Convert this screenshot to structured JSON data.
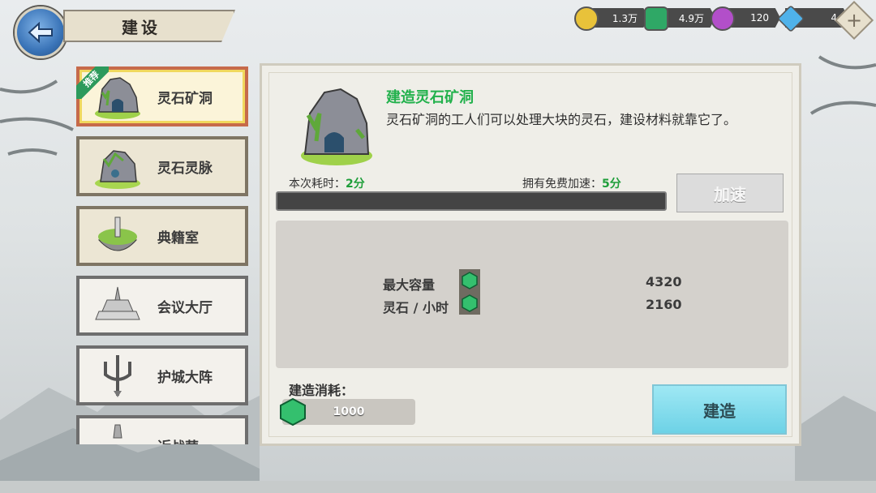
{
  "header": {
    "title": "建设"
  },
  "resources": [
    {
      "name": "gold",
      "icon": "gold-coin-icon",
      "value": "1.3万",
      "color": "#e8c23a"
    },
    {
      "name": "spirit-stone",
      "icon": "green-gem-icon",
      "value": "4.9万",
      "color": "#2fa866"
    },
    {
      "name": "purple",
      "icon": "purple-orb-icon",
      "value": "120",
      "color": "#b24fc9"
    },
    {
      "name": "diamond",
      "icon": "diamond-icon",
      "value": "4",
      "color": "#4fb2ea"
    }
  ],
  "sidebar": {
    "recommend_badge": "推荐",
    "items": [
      {
        "label": "灵石矿洞",
        "icon": "cave-building-icon",
        "selected": true
      },
      {
        "label": "灵石灵脉",
        "icon": "vein-building-icon"
      },
      {
        "label": "典籍室",
        "icon": "library-island-icon"
      },
      {
        "label": "会议大厅",
        "icon": "hall-building-icon"
      },
      {
        "label": "护城大阵",
        "icon": "trident-array-icon"
      },
      {
        "label": "近战营",
        "icon": "barracks-icon"
      }
    ]
  },
  "detail": {
    "title": "建造灵石矿洞",
    "description": "灵石矿洞的工人们可以处理大块的灵石，建设材料就靠它了。",
    "time_label": "本次耗时：",
    "time_value": "2分",
    "free_label": "拥有免费加速：",
    "free_value": "5分",
    "speed_button": "加速",
    "progress": 0,
    "stats": [
      {
        "label": "最大容量",
        "value": "4320"
      },
      {
        "label": "灵石 / 小时",
        "value": "2160"
      }
    ],
    "cost_label": "建造消耗：",
    "cost_value": "1000",
    "build_button": "建造"
  }
}
